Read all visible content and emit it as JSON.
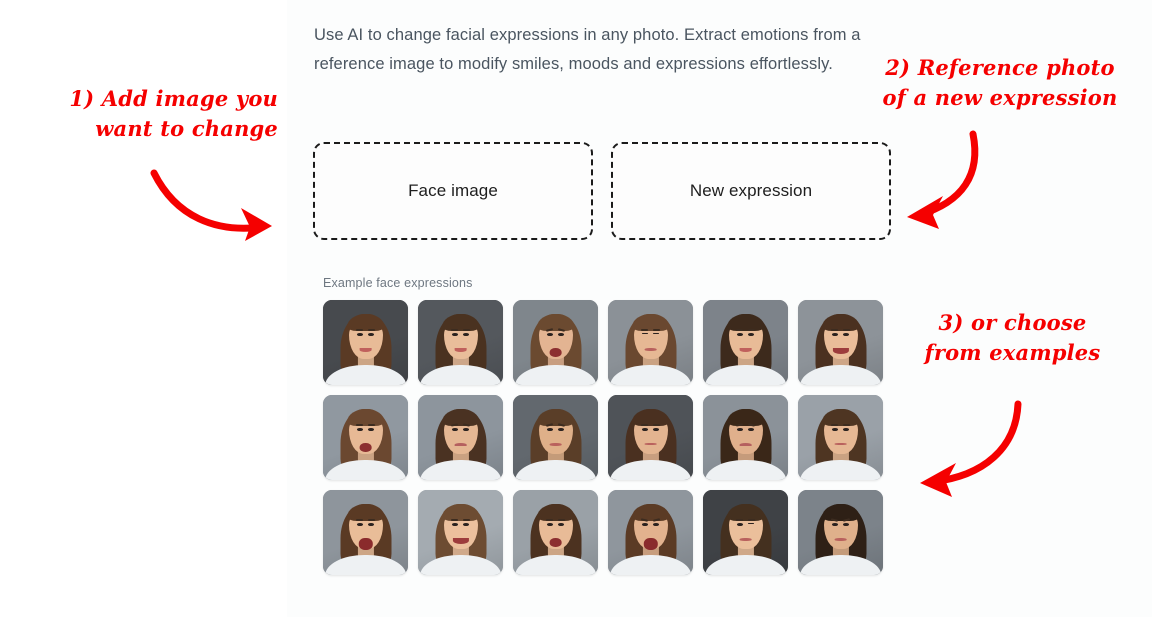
{
  "page": {
    "background_color": "#ffffff",
    "panel_color": "#fcfdfd",
    "accent_color": "#f50000",
    "text_color": "#4a5560"
  },
  "intro": {
    "text": "Use AI to change facial expressions in any photo. Extract emotions from a reference image to modify smiles, moods and expressions effortlessly."
  },
  "dropzones": {
    "face": {
      "label": "Face image"
    },
    "expression": {
      "label": "New expression"
    }
  },
  "examples": {
    "label": "Example face expressions",
    "thumbnails": [
      {
        "expression": "smiling",
        "variant": "smile",
        "backdrop": "#474a4e",
        "hair": "#5a3a24",
        "skin": "#e8bb97"
      },
      {
        "expression": "smiling",
        "variant": "smile",
        "backdrop": "#54585d",
        "hair": "#4a3220",
        "skin": "#e9bd9a"
      },
      {
        "expression": "worried-open-mouth",
        "variant": "open worried",
        "backdrop": "#7f868c",
        "hair": "#6b4a30",
        "skin": "#e3b492"
      },
      {
        "expression": "eyes-closed",
        "variant": "closed",
        "backdrop": "#8b9197",
        "hair": "#6a4830",
        "skin": "#e6b894"
      },
      {
        "expression": "smiling",
        "variant": "smile",
        "backdrop": "#7d838a",
        "hair": "#3d2a1c",
        "skin": "#e8bb97"
      },
      {
        "expression": "smiling",
        "variant": "bigsmile",
        "backdrop": "#8d9399",
        "hair": "#4b3120",
        "skin": "#eabd99"
      },
      {
        "expression": "yawning",
        "variant": "open",
        "backdrop": "#9098a0",
        "hair": "#6b4830",
        "skin": "#e7b995"
      },
      {
        "expression": "sad",
        "variant": "sad",
        "backdrop": "#8d959d",
        "hair": "#4a3222",
        "skin": "#e5b793"
      },
      {
        "expression": "worried",
        "variant": "worried",
        "backdrop": "#62686e",
        "hair": "#5a3e28",
        "skin": "#dfb089"
      },
      {
        "expression": "neutral",
        "variant": "neutral",
        "backdrop": "#4f5358",
        "hair": "#4a3020",
        "skin": "#e3b490"
      },
      {
        "expression": "sad",
        "variant": "sad",
        "backdrop": "#8b9299",
        "hair": "#3a2718",
        "skin": "#e0b08c"
      },
      {
        "expression": "neutral",
        "variant": "neutral",
        "backdrop": "#9aa1a8",
        "hair": "#4e3522",
        "skin": "#e6b894"
      },
      {
        "expression": "laughing-tongue",
        "variant": "shout",
        "backdrop": "#8e959c",
        "hair": "#5a3a24",
        "skin": "#e9bd98"
      },
      {
        "expression": "happy",
        "variant": "bigsmile",
        "backdrop": "#a4abb1",
        "hair": "#6d4c32",
        "skin": "#ecc09d"
      },
      {
        "expression": "surprised",
        "variant": "open",
        "backdrop": "#9aa1a7",
        "hair": "#4c3220",
        "skin": "#e8bb97"
      },
      {
        "expression": "shouting-angry",
        "variant": "shout angry",
        "backdrop": "#8f969d",
        "hair": "#5b3b25",
        "skin": "#e2b28e"
      },
      {
        "expression": "winking",
        "variant": "wink",
        "backdrop": "#3f4246",
        "hair": "#44301f",
        "skin": "#ebbf9b"
      },
      {
        "expression": "angry-frowning",
        "variant": "angry",
        "backdrop": "#7c838a",
        "hair": "#2e2016",
        "skin": "#dfb08b"
      }
    ]
  },
  "annotations": [
    {
      "id": 1,
      "text": "1) Add image you\nwant to change"
    },
    {
      "id": 2,
      "text": "2) Reference photo\nof a new expression"
    },
    {
      "id": 3,
      "text": "3) or choose\nfrom examples"
    }
  ]
}
